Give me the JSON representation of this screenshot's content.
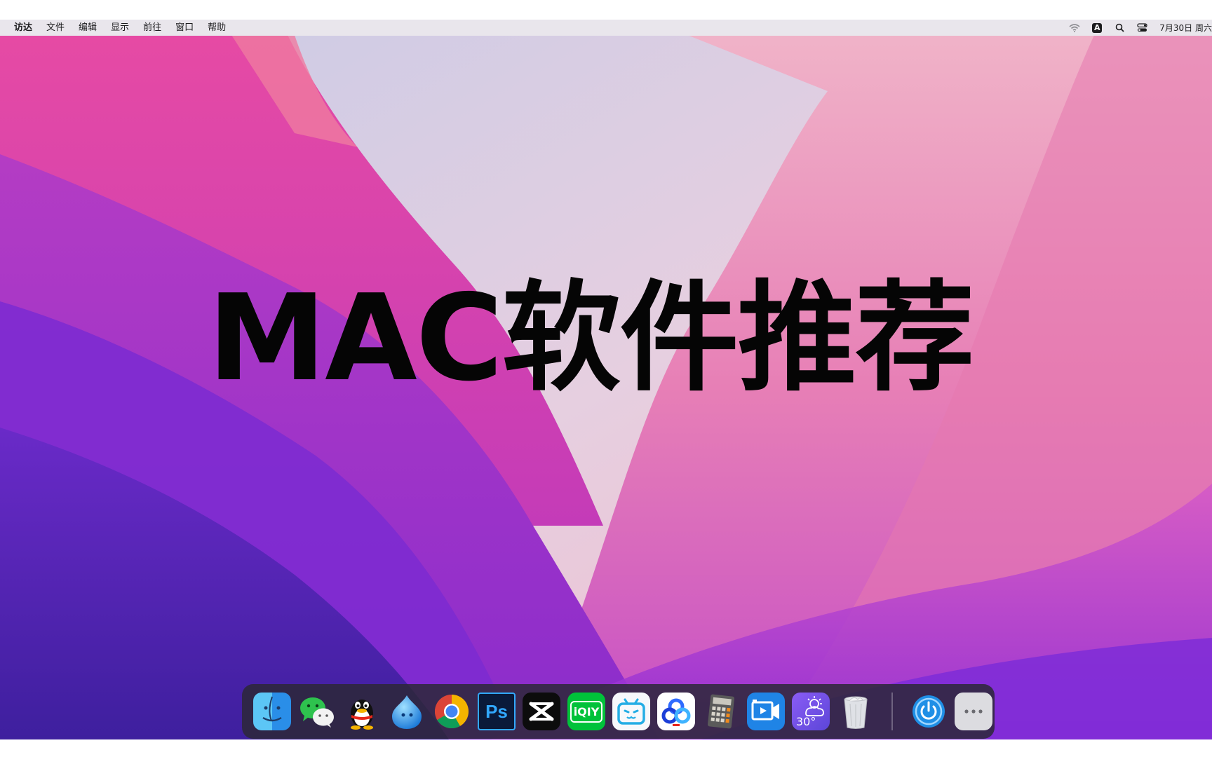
{
  "menubar": {
    "items": [
      "访达",
      "文件",
      "编辑",
      "显示",
      "前往",
      "窗口",
      "帮助"
    ],
    "input_source": "A",
    "clock": "7月30日 周六"
  },
  "hero": {
    "title": "MAC软件推荐"
  },
  "dock": {
    "apps": [
      {
        "name": "Finder",
        "icon": "finder-icon"
      },
      {
        "name": "WeChat",
        "icon": "wechat-icon"
      },
      {
        "name": "QQ",
        "icon": "qq-icon"
      },
      {
        "name": "Xunlei",
        "icon": "xunlei-icon"
      },
      {
        "name": "Chrome",
        "icon": "chrome-icon"
      },
      {
        "name": "Photoshop",
        "icon": "photoshop-icon",
        "label": "Ps"
      },
      {
        "name": "CapCut",
        "icon": "capcut-icon"
      },
      {
        "name": "iQIYI",
        "icon": "iqiyi-icon",
        "label": "iQIY"
      },
      {
        "name": "Bilibili",
        "icon": "bilibili-icon"
      },
      {
        "name": "Baidu Netdisk",
        "icon": "baidu-netdisk-icon"
      },
      {
        "name": "Calculator",
        "icon": "calculator-icon"
      },
      {
        "name": "Screen Recorder",
        "icon": "screen-recorder-icon"
      },
      {
        "name": "Weather",
        "icon": "weather-icon",
        "temperature": "30°"
      },
      {
        "name": "Trash",
        "icon": "trash-icon"
      }
    ],
    "extras": [
      {
        "name": "Power",
        "icon": "power-icon"
      },
      {
        "name": "More",
        "icon": "more-icon"
      }
    ]
  },
  "colors": {
    "menubar_bg": "#e9e6ec",
    "dock_bg": "#2c2838",
    "wallpaper_pink": "#d64aa8",
    "wallpaper_purple": "#5b22c2",
    "title_color": "#050505"
  }
}
